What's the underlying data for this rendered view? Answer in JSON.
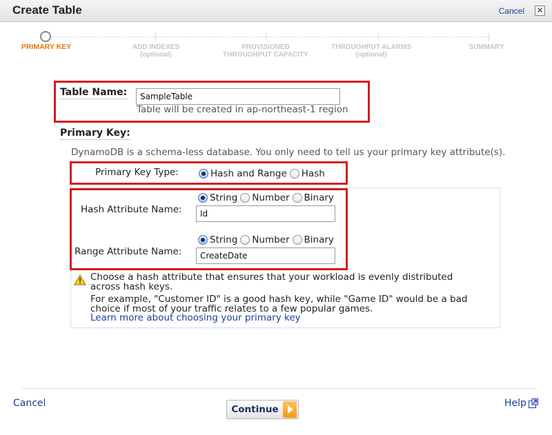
{
  "dialog": {
    "title": "Create Table",
    "cancel_label": "Cancel",
    "close_symbol": "✕"
  },
  "wizard": {
    "steps": [
      {
        "label": "PRIMARY KEY",
        "sub": "",
        "current": true
      },
      {
        "label": "ADD INDEXES",
        "sub": "(optional)",
        "current": false
      },
      {
        "label": "PROVISIONED",
        "sub": "THROUGHPUT CAPACITY",
        "current": false
      },
      {
        "label": "THROUGHPUT ALARMS",
        "sub": "(optional)",
        "current": false
      },
      {
        "label": "SUMMARY",
        "sub": "",
        "current": false
      }
    ]
  },
  "table_name": {
    "label": "Table Name:",
    "value": "SampleTable",
    "hint": "Table will be created in ap-northeast-1 region"
  },
  "primary_key": {
    "heading": "Primary Key:",
    "description": "DynamoDB is a schema-less database. You only need to tell us your primary key attribute(s).",
    "type_label": "Primary Key Type:",
    "type_options": [
      {
        "label": "Hash and Range",
        "checked": true
      },
      {
        "label": "Hash",
        "checked": false
      }
    ]
  },
  "hash_attribute": {
    "label": "Hash Attribute Name:",
    "value": "Id",
    "types": [
      {
        "label": "String",
        "checked": true
      },
      {
        "label": "Number",
        "checked": false
      },
      {
        "label": "Binary",
        "checked": false
      }
    ]
  },
  "range_attribute": {
    "label": "Range Attribute Name:",
    "value": "CreateDate",
    "types": [
      {
        "label": "String",
        "checked": true
      },
      {
        "label": "Number",
        "checked": false
      },
      {
        "label": "Binary",
        "checked": false
      }
    ]
  },
  "info": {
    "icon": "warning-icon",
    "line1": "Choose a hash attribute that ensures that your workload is evenly distributed",
    "line2": "across hash keys.",
    "line3": "For example, \"Customer ID\" is a good hash key, while \"Game ID\" would be a bad",
    "line4": "choice if most of your traffic relates to a few popular games.",
    "link": "Learn more about choosing your primary key"
  },
  "footer": {
    "cancel_label": "Cancel",
    "continue_label": "Continue",
    "help_label": "Help"
  },
  "colors": {
    "highlight": "#d7191c",
    "link": "#1a3f94",
    "step_current": "#e8730c",
    "step_inactive": "#c6c6c6",
    "continue_arrow": "#f29a12"
  }
}
